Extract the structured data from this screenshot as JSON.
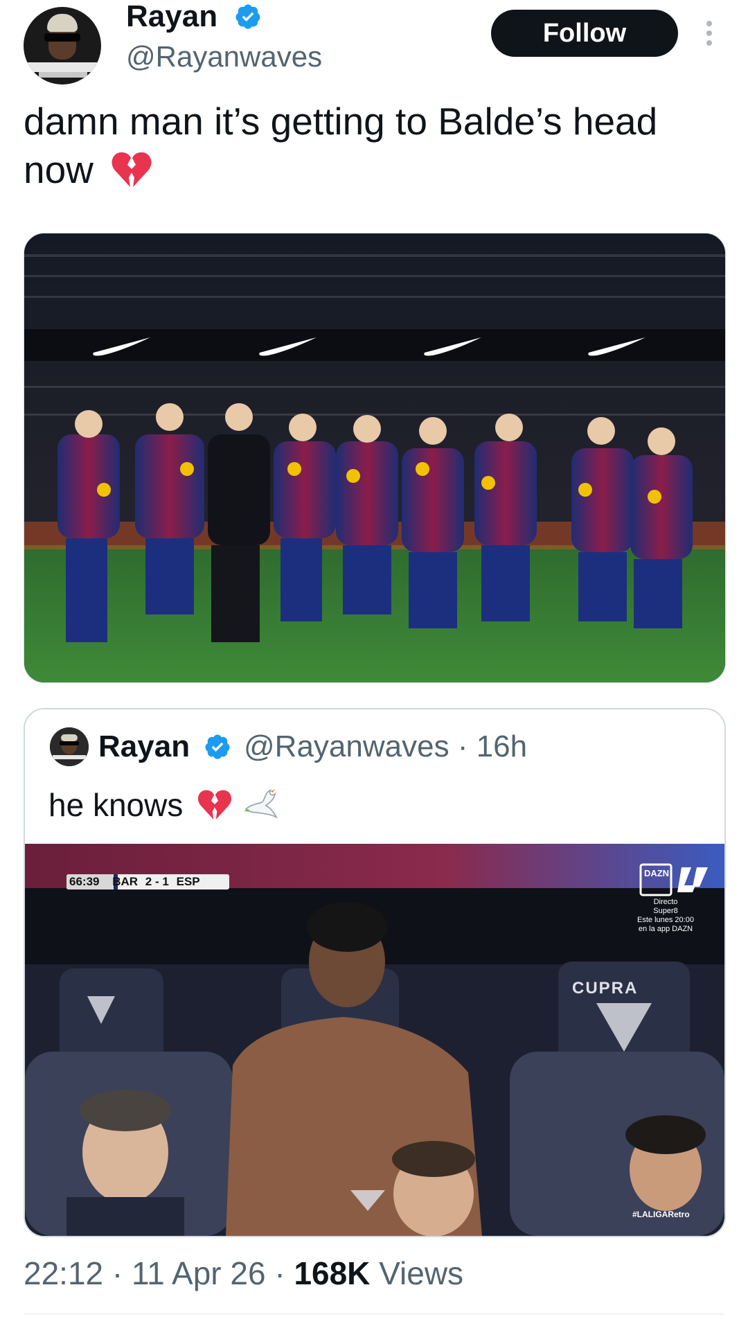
{
  "author": {
    "name": "Rayan",
    "handle": "@Rayanwaves",
    "verified": true
  },
  "follow_button": {
    "label": "Follow"
  },
  "tweet": {
    "text": "damn man it’s getting to Balde’s head now",
    "emoji": "broken-heart"
  },
  "quoted_tweet": {
    "name": "Rayan",
    "handle": "@Rayanwaves",
    "separator": "·",
    "time": "16h",
    "text": "he knows",
    "emojis": [
      "broken-heart",
      "dove"
    ],
    "scoreboard": {
      "clock": "66:39",
      "home": "BAR",
      "home_score": "2",
      "dash": "-",
      "away_score": "1",
      "away": "ESP"
    },
    "broadcast": {
      "logo": "DAZN",
      "line1": "Directo",
      "line2": "Super8",
      "line3": "Este lunes 20:00",
      "line4": "en la app DAZN"
    },
    "seat_brand": "CUPRA",
    "watermark": "#LALIGARetro"
  },
  "meta": {
    "time": "22:12",
    "separator": "·",
    "date": "11 Apr 26",
    "views_count": "168K",
    "views_label": "Views"
  },
  "colors": {
    "text": "#0f1419",
    "secondary": "#536471",
    "verified_blue": "#1d9bf0",
    "border": "#cfd9de",
    "button_bg": "#0f1419",
    "barca_blue": "#1d2a6b",
    "barca_red": "#a50044"
  }
}
